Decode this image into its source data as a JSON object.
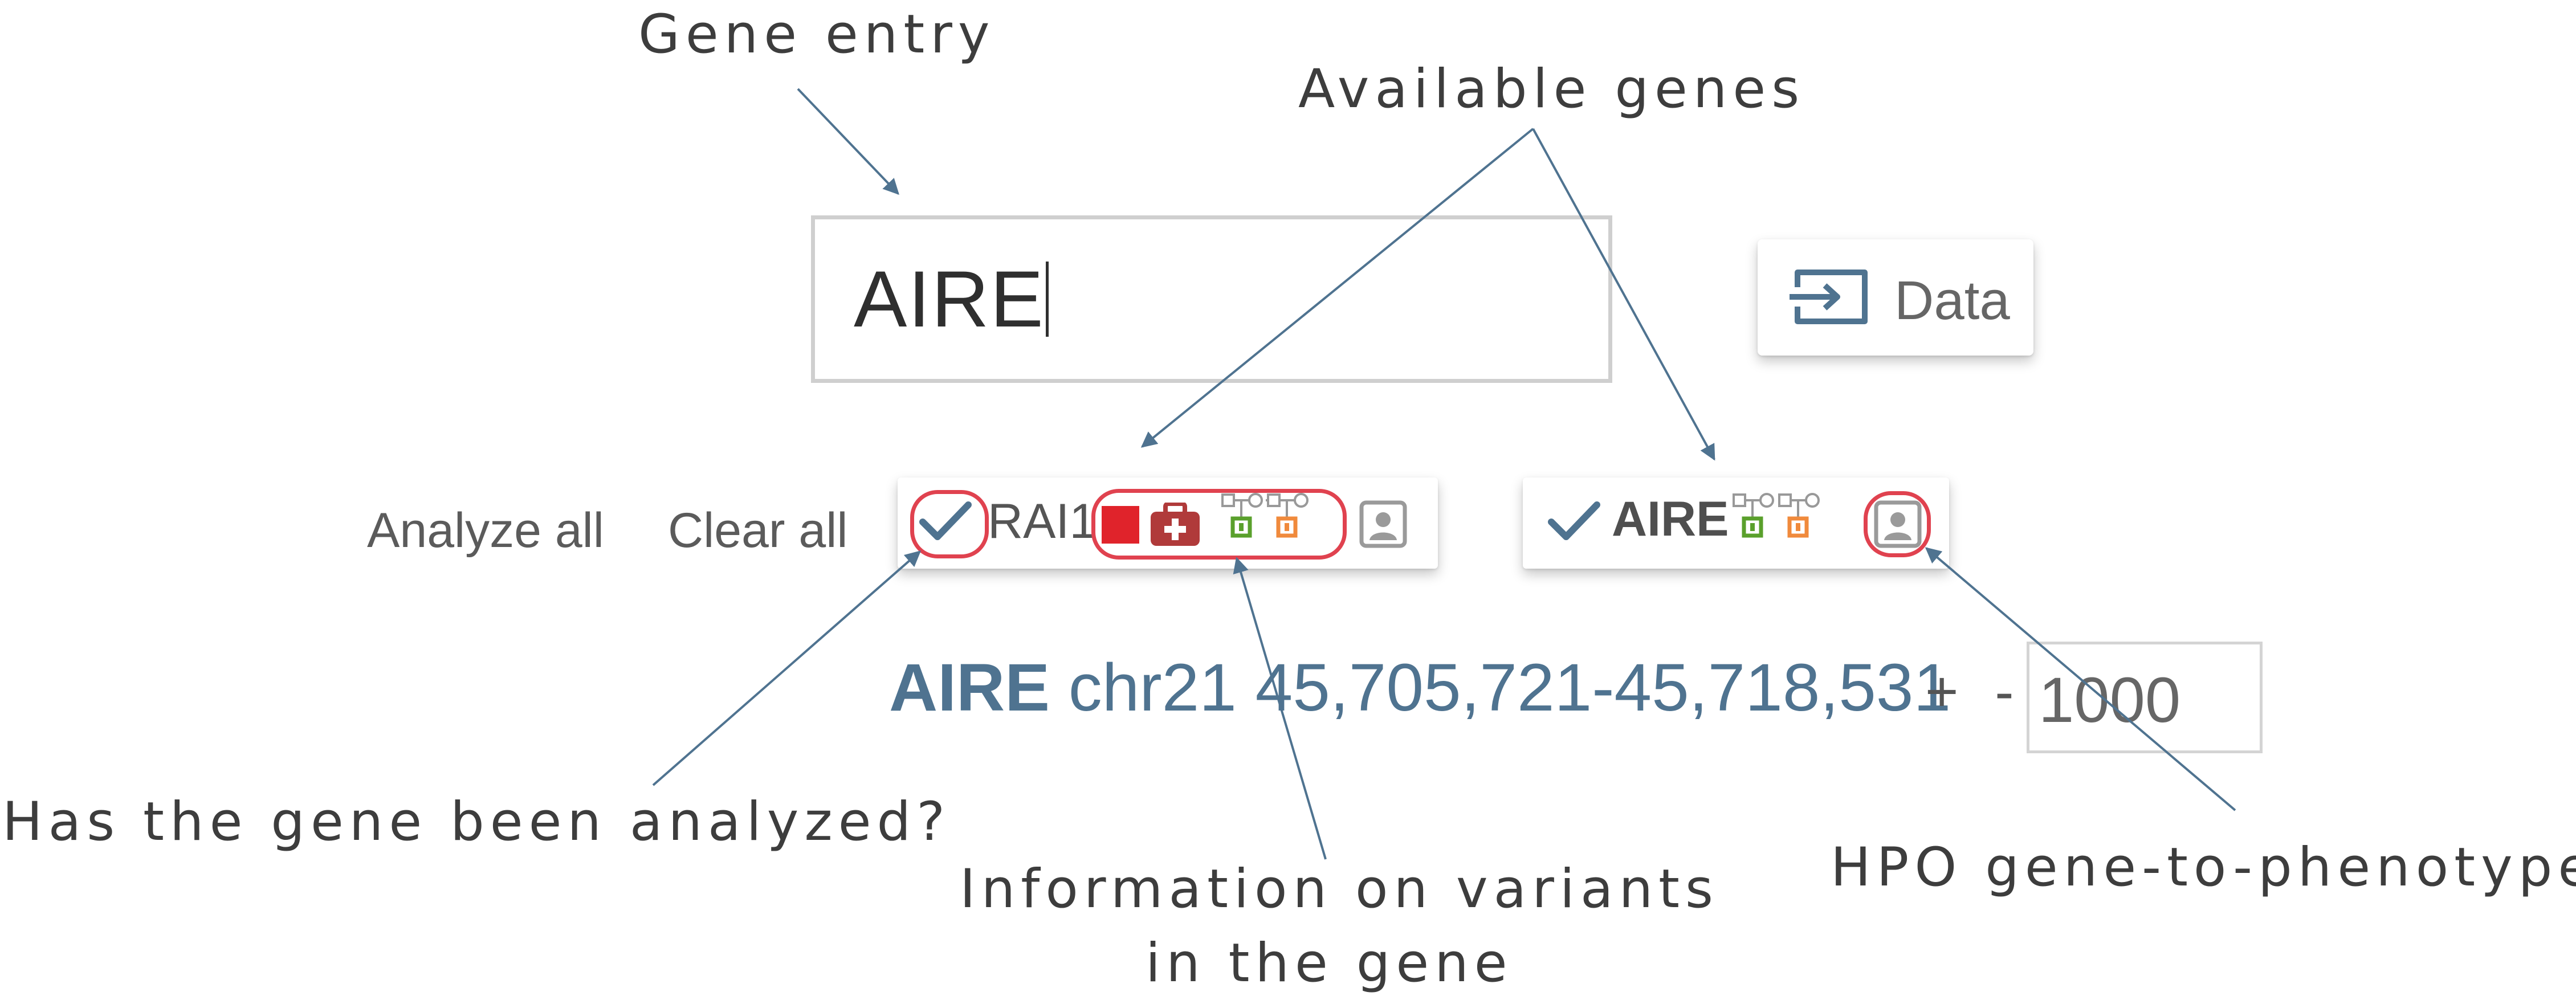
{
  "annotations": {
    "gene_entry": "Gene entry",
    "available_genes": "Available genes",
    "analyzed_question": "Has the gene been analyzed?",
    "variant_info_line1": "Information on variants",
    "variant_info_line2": "in the gene",
    "hpo": "HPO gene-to-phenotype"
  },
  "gene_input": {
    "value": "AIRE"
  },
  "data_button": {
    "label": "Data",
    "icon": "data-import-icon"
  },
  "actions": {
    "analyze_all": "Analyze all",
    "clear_all": "Clear all"
  },
  "gene_cards": [
    {
      "name": "RAI1",
      "analyzed": true,
      "icons": [
        "checkmark-icon",
        "red-square-icon",
        "medical-kit-icon",
        "pedigree-green-icon",
        "pedigree-orange-icon",
        "hpo-person-icon"
      ]
    },
    {
      "name": "AIRE",
      "analyzed": true,
      "icons": [
        "checkmark-icon",
        "pedigree-green-icon",
        "pedigree-orange-icon",
        "hpo-person-icon"
      ]
    }
  ],
  "locus": {
    "gene": "AIRE",
    "region": "chr21 45,705,721-45,718,531",
    "plus": "+",
    "minus": "-",
    "flank_value": "1000"
  },
  "colors": {
    "accent_blue": "#4f7390",
    "annotation_red": "#e0424f",
    "red_square": "#e0232b",
    "medkit": "#b03a3a",
    "pedigree_green": "#5aa02c",
    "pedigree_orange": "#f08a3c"
  }
}
